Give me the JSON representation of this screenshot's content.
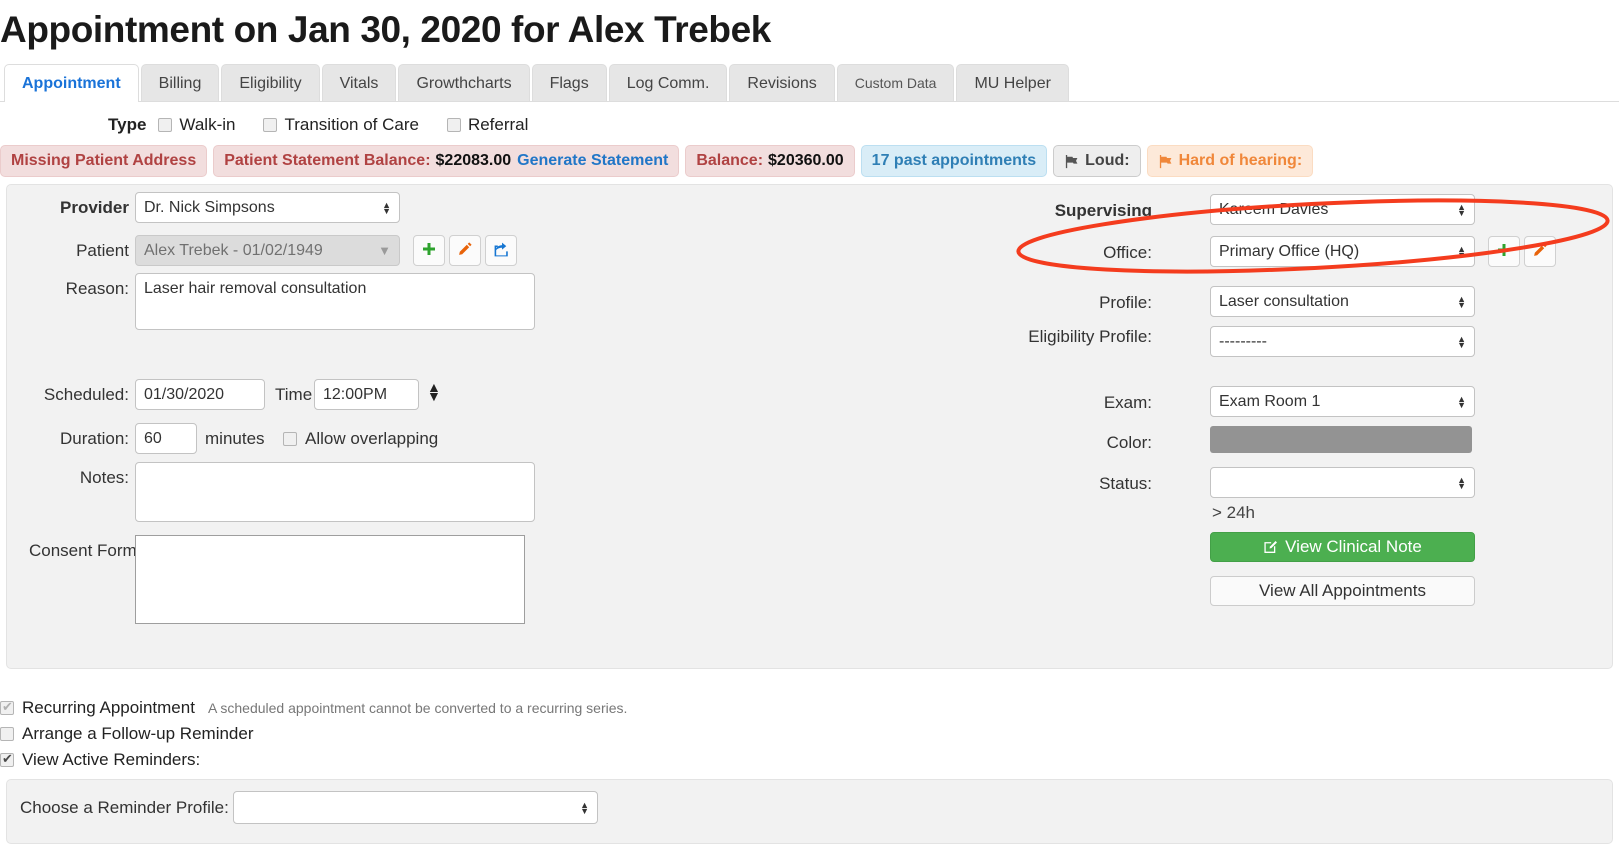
{
  "page": {
    "title": "Appointment on Jan 30, 2020 for Alex Trebek"
  },
  "tabs": [
    {
      "label": "Appointment",
      "active": true
    },
    {
      "label": "Billing",
      "active": false
    },
    {
      "label": "Eligibility",
      "active": false
    },
    {
      "label": "Vitals",
      "active": false
    },
    {
      "label": "Growthcharts",
      "active": false
    },
    {
      "label": "Flags",
      "active": false
    },
    {
      "label": "Log Comm.",
      "active": false
    },
    {
      "label": "Revisions",
      "active": false
    },
    {
      "label": "Custom Data",
      "active": false
    },
    {
      "label": "MU Helper",
      "active": false
    }
  ],
  "type_row": {
    "label": "Type",
    "options": [
      {
        "label": "Walk-in",
        "checked": false
      },
      {
        "label": "Transition of Care",
        "checked": false
      },
      {
        "label": "Referral",
        "checked": false
      }
    ]
  },
  "badges": {
    "missing_address": "Missing Patient Address",
    "statement_label": "Patient Statement Balance:",
    "statement_amount": "$22083.00",
    "generate_statement": "Generate Statement",
    "balance_label": "Balance:",
    "balance_amount": "$20360.00",
    "past_appointments": "17 past appointments",
    "loud": "Loud:",
    "hard_of_hearing": "Hard of hearing:"
  },
  "form": {
    "provider_label": "Provider",
    "provider_value": "Dr. Nick Simpsons",
    "patient_label": "Patient",
    "patient_value": "Alex Trebek - 01/02/1949",
    "reason_label": "Reason:",
    "reason_value": "Laser hair removal consultation",
    "scheduled_label": "Scheduled:",
    "scheduled_value": "01/30/2020",
    "time_label": "Time",
    "time_value": "12:00PM",
    "duration_label": "Duration:",
    "duration_value": "60",
    "minutes_label": "minutes",
    "allow_overlapping_label": "Allow overlapping",
    "allow_overlapping_checked": false,
    "notes_label": "Notes:",
    "notes_value": "",
    "consent_label": "Consent Forms:",
    "consent_value": "",
    "supervising_label": "Supervising",
    "supervising_value": "Kareem Davies",
    "office_label": "Office:",
    "office_value": "Primary Office (HQ)",
    "profile_label": "Profile:",
    "profile_value": "Laser consultation",
    "eligibility_label": "Eligibility Profile:",
    "eligibility_value": "---------",
    "exam_label": "Exam:",
    "exam_value": "Exam Room 1",
    "color_label": "Color:",
    "color_value": "#939393",
    "status_label": "Status:",
    "status_value": "",
    "time_until": "> 24h",
    "view_clinical_note": "View Clinical Note",
    "view_all_appointments": "View All Appointments"
  },
  "bottom": {
    "recurring_label": "Recurring Appointment",
    "recurring_checked": true,
    "recurring_hint": "A scheduled appointment cannot be converted to a recurring series.",
    "followup_label": "Arrange a Follow-up Reminder",
    "followup_checked": false,
    "active_reminders_label": "View Active Reminders:",
    "active_reminders_checked": true,
    "reminder_profile_label": "Choose a Reminder Profile:",
    "reminder_profile_value": ""
  },
  "colors": {
    "accent_blue": "#1a73d8",
    "green_button": "#4caf50",
    "annotation_red": "#f43c1e",
    "color_swatch": "#939393"
  }
}
